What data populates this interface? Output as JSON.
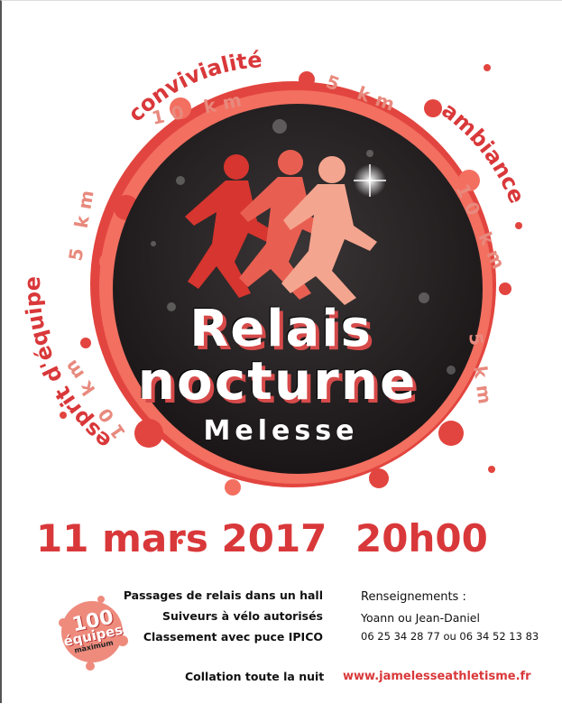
{
  "event": {
    "title_line1": "Relais",
    "title_line2": "nocturne",
    "town": "Melesse",
    "date": "11 mars 2017",
    "time": "20h00"
  },
  "ring_words": {
    "convivialite": "convivialité",
    "ambiance": "ambiance",
    "esprit": "esprit d'équipe",
    "ten_km": "10 km",
    "five_km": "5 km"
  },
  "features": [
    "Passages de relais dans un hall",
    "Suiveurs à vélo autorisés",
    "Classement avec puce IPICO"
  ],
  "contact": {
    "title": "Renseignements :",
    "names": "Yoann ou Jean-Daniel",
    "phones": "06 25 34 28 77 ou 06 34 52 13 83"
  },
  "badge": {
    "number": "100",
    "label": "équipes",
    "note": "maximum"
  },
  "footer": {
    "collation": "Collation toute la nuit",
    "website": "www.jamelesseathletisme.fr"
  },
  "colors": {
    "accent": "#d9383a",
    "light_accent": "#f08a80",
    "disc": "#231f20"
  }
}
